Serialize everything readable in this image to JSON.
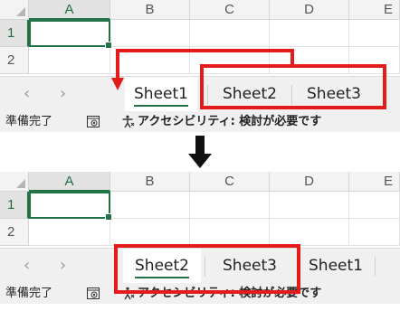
{
  "colors": {
    "accent": "#217346",
    "highlight": "#e31b1b"
  },
  "columns": [
    "A",
    "B",
    "C",
    "D",
    "E"
  ],
  "rows": [
    "1",
    "2"
  ],
  "panel_before": {
    "sheets": [
      "Sheet1",
      "Sheet2",
      "Sheet3"
    ],
    "active_sheet": "Sheet1"
  },
  "panel_after": {
    "sheets": [
      "Sheet2",
      "Sheet3",
      "Sheet1"
    ],
    "active_sheet": "Sheet2"
  },
  "nav": {
    "prev_icon": "chevron-left-icon",
    "next_icon": "chevron-right-icon",
    "prev": "‹",
    "next": "›"
  },
  "status": {
    "ready": "準備完了",
    "accessibility": "アクセシビリティ: 検討が必要です",
    "macro_icon": "macro-record-icon",
    "accessibility_icon": "accessibility-icon"
  },
  "transition_icon": "down-arrow-icon"
}
